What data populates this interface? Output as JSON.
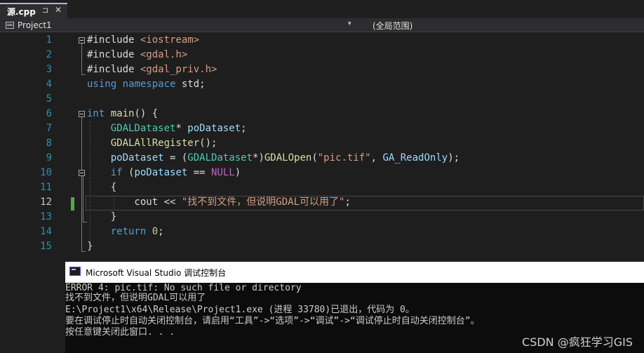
{
  "tab": {
    "title": "源.cpp",
    "pin": "⊐",
    "close": "✕"
  },
  "navbar": {
    "project": "Project1",
    "dropdown": "▾",
    "scope": "(全局范围)"
  },
  "editor": {
    "line_numbers": [
      "1",
      "2",
      "3",
      "4",
      "5",
      "6",
      "7",
      "8",
      "9",
      "10",
      "11",
      "12",
      "13",
      "14",
      "15"
    ],
    "current_line": "12",
    "lines": [
      [
        {
          "t": "#include ",
          "c": "plain"
        },
        {
          "t": "<iostream>",
          "c": "str"
        }
      ],
      [
        {
          "t": "#include ",
          "c": "plain"
        },
        {
          "t": "<gdal.h>",
          "c": "str"
        }
      ],
      [
        {
          "t": "#include ",
          "c": "plain"
        },
        {
          "t": "<gdal_priv.h>",
          "c": "str"
        }
      ],
      [
        {
          "t": "using",
          "c": "kw"
        },
        {
          "t": " ",
          "c": "plain"
        },
        {
          "t": "namespace",
          "c": "kw"
        },
        {
          "t": " std;",
          "c": "plain"
        }
      ],
      [],
      [
        {
          "t": "int",
          "c": "kw"
        },
        {
          "t": " ",
          "c": "plain"
        },
        {
          "t": "main",
          "c": "fn"
        },
        {
          "t": "() {",
          "c": "plain"
        }
      ],
      [
        {
          "t": "    ",
          "c": "plain"
        },
        {
          "t": "GDALDataset",
          "c": "ty"
        },
        {
          "t": "* ",
          "c": "plain"
        },
        {
          "t": "poDataset",
          "c": "var"
        },
        {
          "t": ";",
          "c": "plain"
        }
      ],
      [
        {
          "t": "    ",
          "c": "plain"
        },
        {
          "t": "GDALAllRegister",
          "c": "fn"
        },
        {
          "t": "();",
          "c": "plain"
        }
      ],
      [
        {
          "t": "    ",
          "c": "plain"
        },
        {
          "t": "poDataset",
          "c": "var"
        },
        {
          "t": " = (",
          "c": "plain"
        },
        {
          "t": "GDALDataset",
          "c": "ty"
        },
        {
          "t": "*)",
          "c": "plain"
        },
        {
          "t": "GDALOpen",
          "c": "fn"
        },
        {
          "t": "(",
          "c": "plain"
        },
        {
          "t": "\"pic.tif\"",
          "c": "str"
        },
        {
          "t": ", ",
          "c": "plain"
        },
        {
          "t": "GA_ReadOnly",
          "c": "var"
        },
        {
          "t": ");",
          "c": "plain"
        }
      ],
      [
        {
          "t": "    ",
          "c": "plain"
        },
        {
          "t": "if",
          "c": "kw"
        },
        {
          "t": " (",
          "c": "plain"
        },
        {
          "t": "poDataset",
          "c": "var"
        },
        {
          "t": " == ",
          "c": "plain"
        },
        {
          "t": "NULL",
          "c": "macro"
        },
        {
          "t": ")",
          "c": "plain"
        }
      ],
      [
        {
          "t": "    {",
          "c": "plain"
        }
      ],
      [
        {
          "t": "        cout << ",
          "c": "plain"
        },
        {
          "t": "\"找不到文件，但说明GDAL可以用了\"",
          "c": "str"
        },
        {
          "t": ";",
          "c": "plain"
        }
      ],
      [
        {
          "t": "    }",
          "c": "plain"
        }
      ],
      [
        {
          "t": "    ",
          "c": "plain"
        },
        {
          "t": "return",
          "c": "kw"
        },
        {
          "t": " ",
          "c": "plain"
        },
        {
          "t": "0",
          "c": "num"
        },
        {
          "t": ";",
          "c": "plain"
        }
      ],
      [
        {
          "t": "}",
          "c": "plain"
        }
      ]
    ]
  },
  "console": {
    "title": "Microsoft Visual Studio 调试控制台",
    "lines": [
      "ERROR 4: pic.tif: No such file or directory",
      "找不到文件，但说明GDAL可以用了",
      "E:\\Project1\\x64\\Release\\Project1.exe (进程 33780)已退出，代码为 0。",
      "要在调试停止时自动关闭控制台，请启用“工具”->“选项”->“调试”->“调试停止时自动关闭控制台”。",
      "按任意键关闭此窗口. . ."
    ]
  },
  "watermark": "CSDN @疯狂学习GIS"
}
